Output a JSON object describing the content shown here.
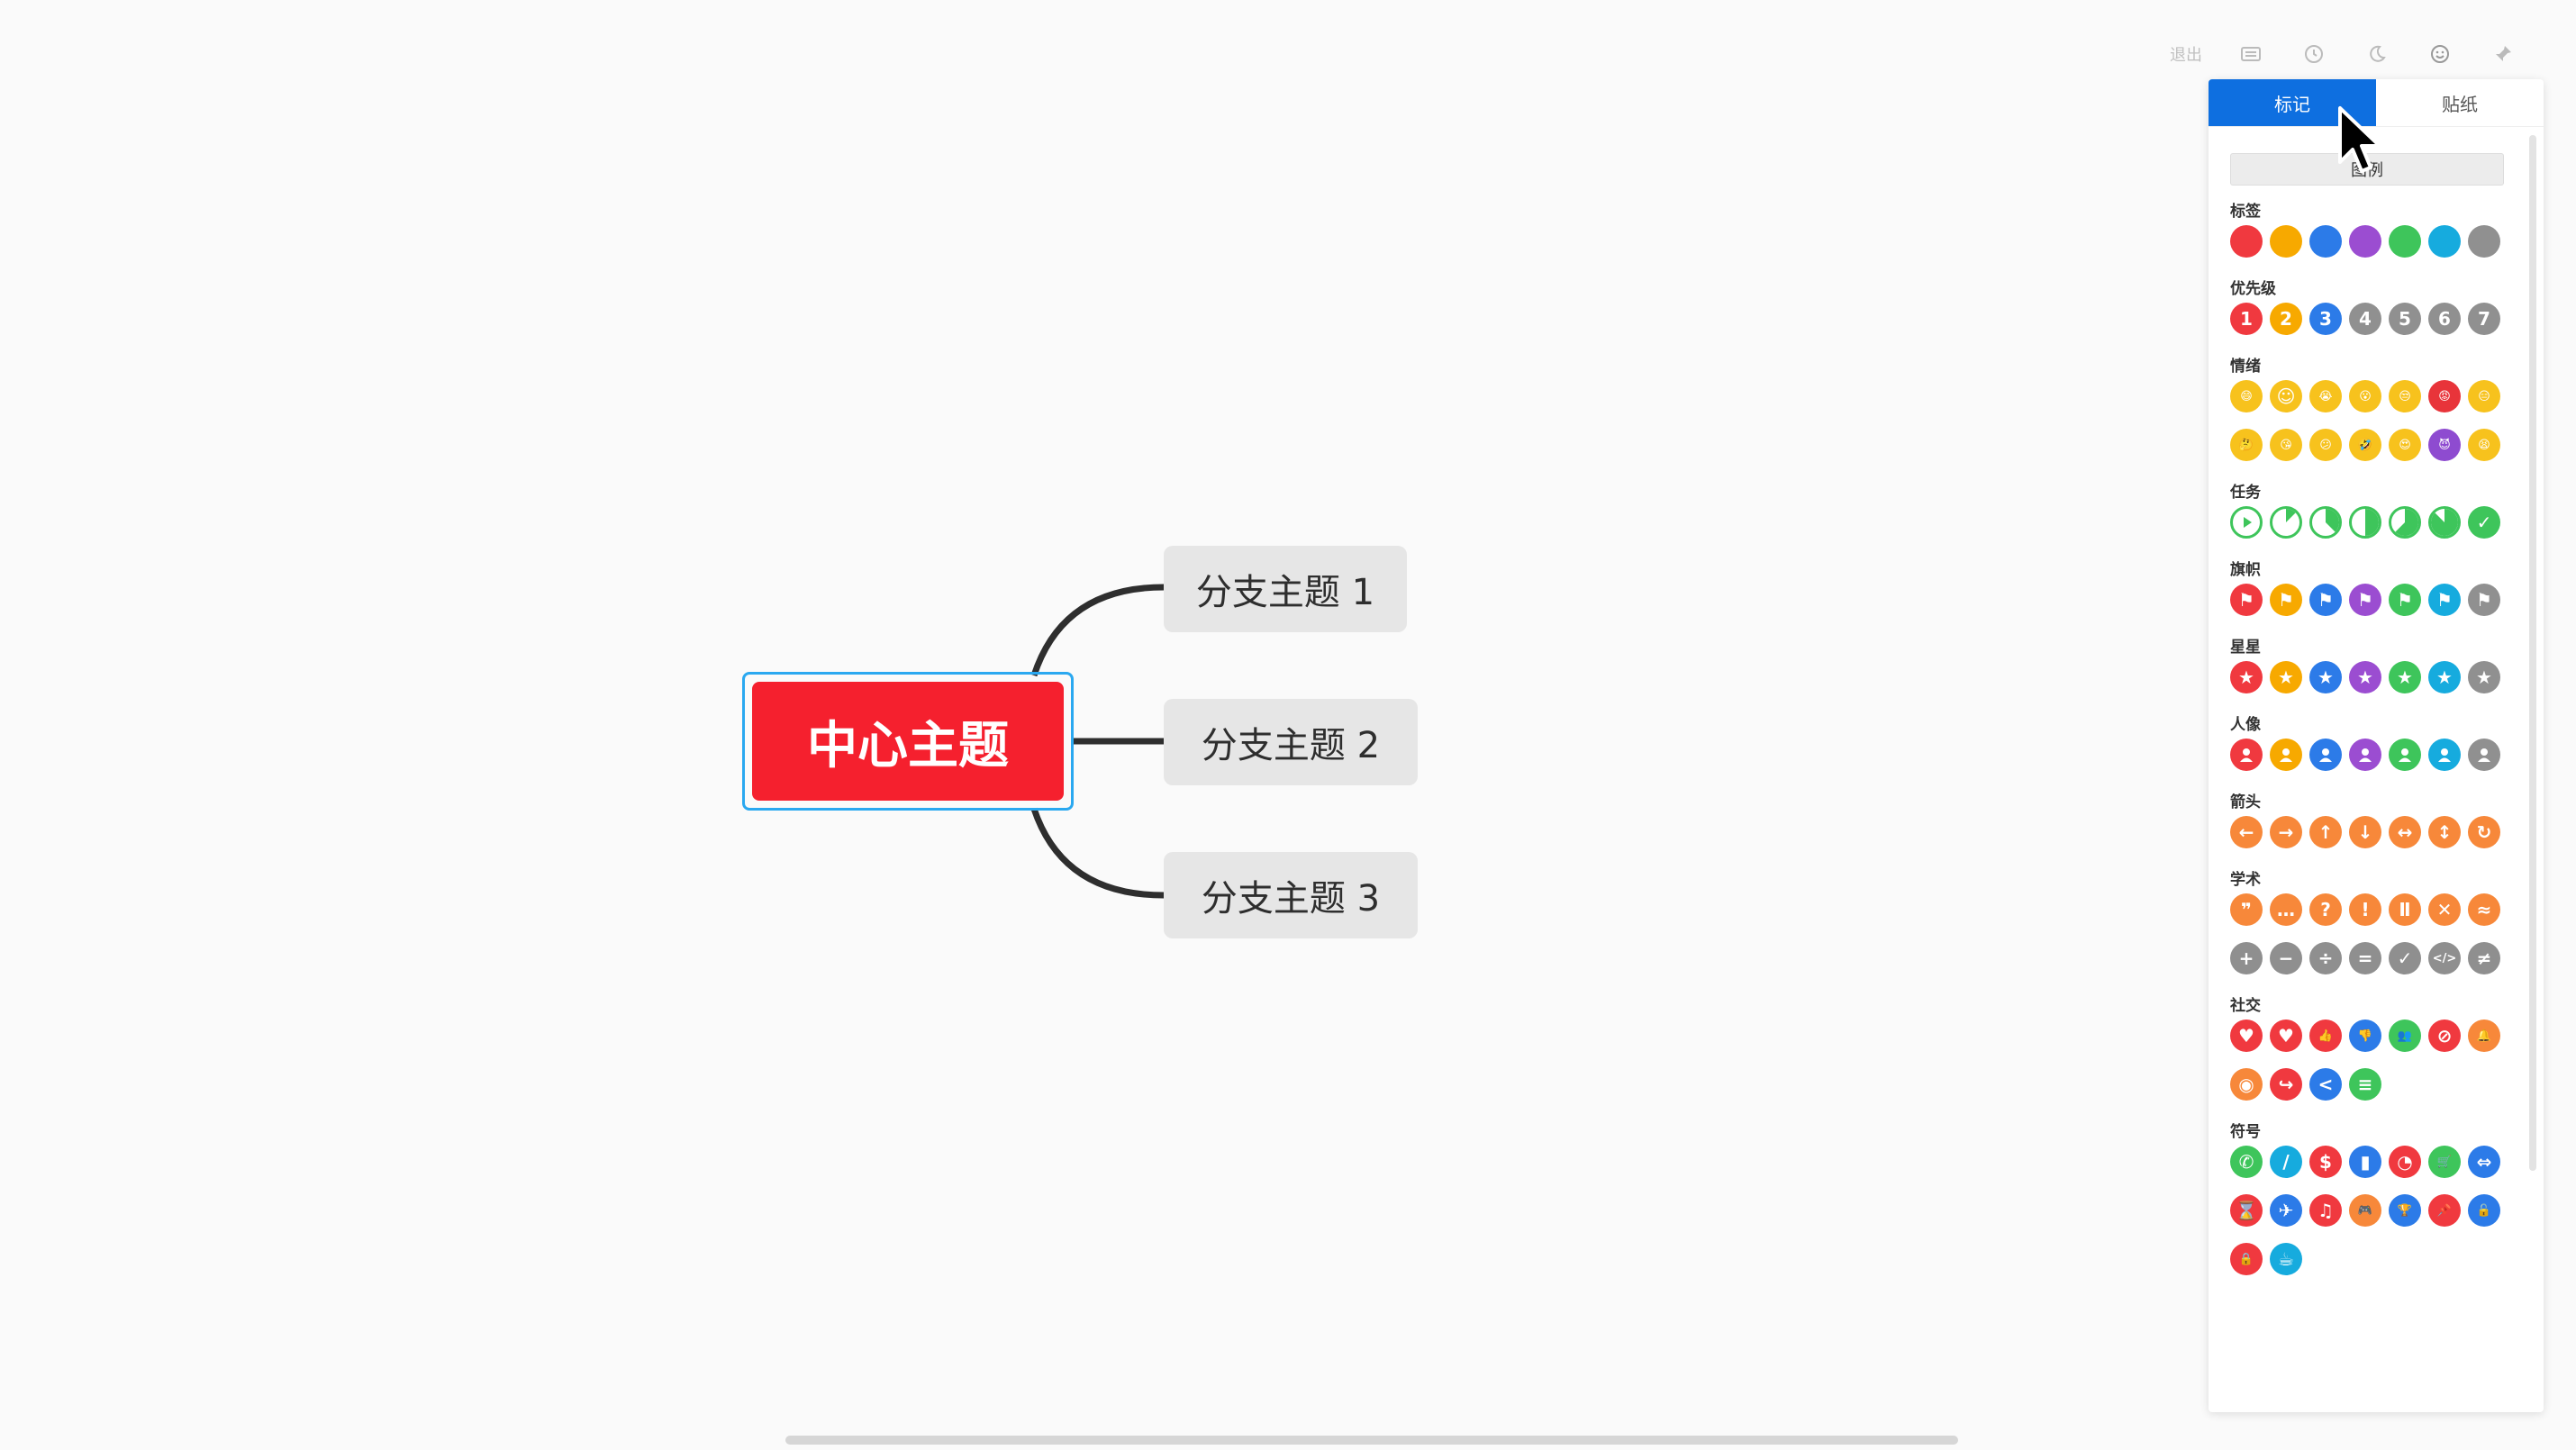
{
  "mindmap": {
    "central_topic": "中心主题",
    "branches": [
      "分支主题 1",
      "分支主题 2",
      "分支主题 3"
    ]
  },
  "toolbar": {
    "exit_label": "退出",
    "icons": [
      "keyboard-icon",
      "history-icon",
      "moon-icon",
      "emoji-icon",
      "pin-icon"
    ]
  },
  "panel": {
    "tabs": [
      {
        "label": "标记",
        "active": true
      },
      {
        "label": "贴纸",
        "active": false
      }
    ],
    "legend_button": "图例",
    "sections": [
      {
        "title": "标签",
        "rows": [
          [
            {
              "kind": "solid",
              "color": "#f0393f"
            },
            {
              "kind": "solid",
              "color": "#f7a900"
            },
            {
              "kind": "solid",
              "color": "#2c7be8"
            },
            {
              "kind": "solid",
              "color": "#9b4dd1"
            },
            {
              "kind": "solid",
              "color": "#3ec55b"
            },
            {
              "kind": "solid",
              "color": "#16abde"
            },
            {
              "kind": "solid",
              "color": "#909090"
            }
          ]
        ]
      },
      {
        "title": "优先级",
        "rows": [
          [
            {
              "kind": "text",
              "t": "1",
              "color": "#f0393f"
            },
            {
              "kind": "text",
              "t": "2",
              "color": "#f7a900"
            },
            {
              "kind": "text",
              "t": "3",
              "color": "#2c7be8"
            },
            {
              "kind": "text",
              "t": "4",
              "color": "#909090"
            },
            {
              "kind": "text",
              "t": "5",
              "color": "#909090"
            },
            {
              "kind": "text",
              "t": "6",
              "color": "#909090"
            },
            {
              "kind": "text",
              "t": "7",
              "color": "#909090"
            }
          ]
        ]
      },
      {
        "title": "情绪",
        "rows": [
          [
            {
              "kind": "text",
              "t": "😄",
              "color": "#f7c21d"
            },
            {
              "kind": "text",
              "t": "☺",
              "color": "#f7c21d"
            },
            {
              "kind": "text",
              "t": "😭",
              "color": "#f7c21d"
            },
            {
              "kind": "text",
              "t": "😮",
              "color": "#f7c21d"
            },
            {
              "kind": "text",
              "t": "😒",
              "color": "#f7c21d"
            },
            {
              "kind": "text",
              "t": "😡",
              "color": "#e8343a"
            },
            {
              "kind": "text",
              "t": "😑",
              "color": "#f7c21d"
            }
          ],
          [
            {
              "kind": "text",
              "t": "🤔",
              "color": "#f7c21d"
            },
            {
              "kind": "text",
              "t": "😘",
              "color": "#f7c21d"
            },
            {
              "kind": "text",
              "t": "😕",
              "color": "#f7c21d"
            },
            {
              "kind": "text",
              "t": "🤣",
              "color": "#f7c21d"
            },
            {
              "kind": "text",
              "t": "😍",
              "color": "#f7c21d"
            },
            {
              "kind": "text",
              "t": "😈",
              "color": "#8e4bd0"
            },
            {
              "kind": "text",
              "t": "😫",
              "color": "#f7c21d"
            }
          ]
        ]
      },
      {
        "title": "任务",
        "rows": [
          [
            {
              "kind": "task",
              "p": 0
            },
            {
              "kind": "task",
              "p": 0.125
            },
            {
              "kind": "task",
              "p": 0.375
            },
            {
              "kind": "task",
              "p": 0.5
            },
            {
              "kind": "task",
              "p": 0.625
            },
            {
              "kind": "task",
              "p": 0.875
            },
            {
              "kind": "text",
              "t": "✓",
              "color": "#3ec55b"
            }
          ]
        ]
      },
      {
        "title": "旗帜",
        "rows": [
          [
            {
              "kind": "text",
              "t": "⚑",
              "color": "#f0393f"
            },
            {
              "kind": "text",
              "t": "⚑",
              "color": "#f7a900"
            },
            {
              "kind": "text",
              "t": "⚑",
              "color": "#2c7be8"
            },
            {
              "kind": "text",
              "t": "⚑",
              "color": "#9b4dd1"
            },
            {
              "kind": "text",
              "t": "⚑",
              "color": "#3ec55b"
            },
            {
              "kind": "text",
              "t": "⚑",
              "color": "#16abde"
            },
            {
              "kind": "text",
              "t": "⚑",
              "color": "#909090"
            }
          ]
        ]
      },
      {
        "title": "星星",
        "rows": [
          [
            {
              "kind": "text",
              "t": "★",
              "color": "#f0393f"
            },
            {
              "kind": "text",
              "t": "★",
              "color": "#f7a900"
            },
            {
              "kind": "text",
              "t": "★",
              "color": "#2c7be8"
            },
            {
              "kind": "text",
              "t": "★",
              "color": "#9b4dd1"
            },
            {
              "kind": "text",
              "t": "★",
              "color": "#3ec55b"
            },
            {
              "kind": "text",
              "t": "★",
              "color": "#16abde"
            },
            {
              "kind": "text",
              "t": "★",
              "color": "#909090"
            }
          ]
        ]
      },
      {
        "title": "人像",
        "rows": [
          [
            {
              "kind": "person",
              "color": "#f0393f"
            },
            {
              "kind": "person",
              "color": "#f7a900"
            },
            {
              "kind": "person",
              "color": "#2c7be8"
            },
            {
              "kind": "person",
              "color": "#9b4dd1"
            },
            {
              "kind": "person",
              "color": "#3ec55b"
            },
            {
              "kind": "person",
              "color": "#16abde"
            },
            {
              "kind": "person",
              "color": "#909090"
            }
          ]
        ]
      },
      {
        "title": "箭头",
        "rows": [
          [
            {
              "kind": "text",
              "t": "←",
              "color": "#f7883a"
            },
            {
              "kind": "text",
              "t": "→",
              "color": "#f7883a"
            },
            {
              "kind": "text",
              "t": "↑",
              "color": "#f7883a"
            },
            {
              "kind": "text",
              "t": "↓",
              "color": "#f7883a"
            },
            {
              "kind": "text",
              "t": "↔",
              "color": "#f7883a"
            },
            {
              "kind": "text",
              "t": "↕",
              "color": "#f7883a"
            },
            {
              "kind": "text",
              "t": "↻",
              "color": "#f7883a"
            }
          ]
        ]
      },
      {
        "title": "学术",
        "rows": [
          [
            {
              "kind": "text",
              "t": "❞",
              "color": "#f7883a"
            },
            {
              "kind": "text",
              "t": "…",
              "color": "#f7883a"
            },
            {
              "kind": "text",
              "t": "?",
              "color": "#f7883a"
            },
            {
              "kind": "text",
              "t": "!",
              "color": "#f7883a"
            },
            {
              "kind": "text",
              "t": "Ⅱ",
              "color": "#f7883a"
            },
            {
              "kind": "text",
              "t": "✕",
              "color": "#f7883a"
            },
            {
              "kind": "text",
              "t": "≈",
              "color": "#f7883a"
            }
          ],
          [
            {
              "kind": "text",
              "t": "+",
              "color": "#8f8f8f"
            },
            {
              "kind": "text",
              "t": "−",
              "color": "#8f8f8f"
            },
            {
              "kind": "text",
              "t": "÷",
              "color": "#8f8f8f"
            },
            {
              "kind": "text",
              "t": "=",
              "color": "#8f8f8f"
            },
            {
              "kind": "text",
              "t": "✓",
              "color": "#8f8f8f"
            },
            {
              "kind": "text",
              "t": "</>",
              "color": "#8f8f8f"
            },
            {
              "kind": "text",
              "t": "≠",
              "color": "#8f8f8f"
            }
          ]
        ]
      },
      {
        "title": "社交",
        "rows": [
          [
            {
              "kind": "text",
              "t": "♥",
              "color": "#f0393f"
            },
            {
              "kind": "text",
              "t": "♥",
              "color": "#f0393f"
            },
            {
              "kind": "text",
              "t": "👍",
              "color": "#f0393f"
            },
            {
              "kind": "text",
              "t": "👎",
              "color": "#2c7be8"
            },
            {
              "kind": "text",
              "t": "👥",
              "color": "#3ec55b"
            },
            {
              "kind": "text",
              "t": "⊘",
              "color": "#f0393f"
            },
            {
              "kind": "text",
              "t": "🔔",
              "color": "#f7883a"
            }
          ],
          [
            {
              "kind": "text",
              "t": "◉",
              "color": "#f7883a"
            },
            {
              "kind": "text",
              "t": "↪",
              "color": "#f0393f"
            },
            {
              "kind": "text",
              "t": "<",
              "color": "#2c7be8"
            },
            {
              "kind": "text",
              "t": "≡",
              "color": "#3ec55b"
            }
          ]
        ]
      },
      {
        "title": "符号",
        "rows": [
          [
            {
              "kind": "text",
              "t": "✆",
              "color": "#3ec55b"
            },
            {
              "kind": "text",
              "t": "/",
              "color": "#16abde"
            },
            {
              "kind": "text",
              "t": "$",
              "color": "#f0393f"
            },
            {
              "kind": "text",
              "t": "▮",
              "color": "#2c7be8"
            },
            {
              "kind": "text",
              "t": "◔",
              "color": "#f0393f"
            },
            {
              "kind": "text",
              "t": "🛒",
              "color": "#3ec55b"
            },
            {
              "kind": "text",
              "t": "⇔",
              "color": "#2c7be8"
            }
          ],
          [
            {
              "kind": "text",
              "t": "⌛",
              "color": "#f0393f"
            },
            {
              "kind": "text",
              "t": "✈",
              "color": "#2c7be8"
            },
            {
              "kind": "text",
              "t": "♫",
              "color": "#f0393f"
            },
            {
              "kind": "text",
              "t": "🎮",
              "color": "#f7883a"
            },
            {
              "kind": "text",
              "t": "🏆",
              "color": "#2c7be8"
            },
            {
              "kind": "text",
              "t": "📌",
              "color": "#f0393f"
            },
            {
              "kind": "text",
              "t": "🔓",
              "color": "#2c7be8"
            }
          ],
          [
            {
              "kind": "text",
              "t": "🔒",
              "color": "#f0393f"
            },
            {
              "kind": "text",
              "t": "☕",
              "color": "#16abde"
            }
          ]
        ]
      }
    ]
  }
}
